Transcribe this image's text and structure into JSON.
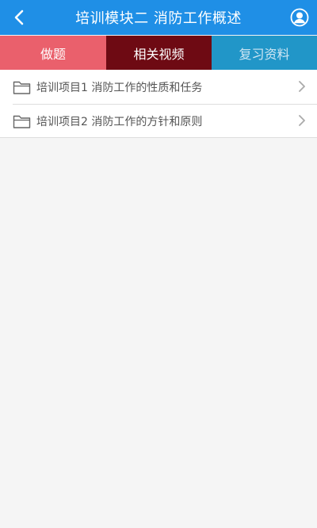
{
  "header": {
    "title": "培训模块二 消防工作概述",
    "back_icon": "chevron-left-icon",
    "user_icon": "user-avatar-icon",
    "color": "#1f8fe6"
  },
  "tabs": [
    {
      "label": "做题",
      "color": "#ea606c"
    },
    {
      "label": "相关视频",
      "color": "#6e0a13",
      "selected": true
    },
    {
      "label": "复习资料",
      "color": "#2196c8"
    }
  ],
  "list": {
    "items": [
      {
        "label": "培训项目1 消防工作的性质和任务",
        "icon": "folder-icon"
      },
      {
        "label": "培训项目2 消防工作的方针和原则",
        "icon": "folder-icon"
      }
    ]
  }
}
